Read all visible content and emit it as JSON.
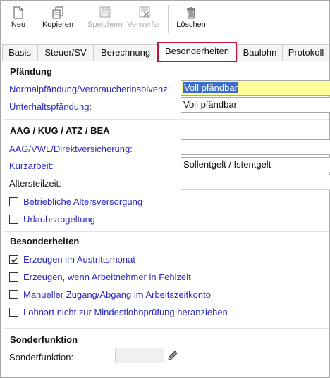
{
  "toolbar": {
    "new_label": "Neu",
    "copy_label": "Kopieren",
    "save_label": "Speichern",
    "discard_label": "Verwerfen",
    "delete_label": "Löschen"
  },
  "tabs": [
    {
      "label": "Basis"
    },
    {
      "label": "Steuer/SV"
    },
    {
      "label": "Berechnung"
    },
    {
      "label": "Besonderheiten"
    },
    {
      "label": "Baulohn"
    },
    {
      "label": "Protokoll"
    }
  ],
  "pfaendung": {
    "title": "Pfändung",
    "normal_label": "Normalpfändung/Verbraucherinsolvenz:",
    "normal_value": "Voll pfändbar",
    "unterhalt_label": "Unterhaltspfändung:",
    "unterhalt_value": "Voll pfändbar"
  },
  "aag": {
    "title": "AAG / KUG / ATZ / BEA",
    "vwl_label": "AAG/VWL/Direktversicherung:",
    "vwl_value": "",
    "kurzarbeit_label": "Kurzarbeit:",
    "kurzarbeit_value": "Sollentgelt / Istentgelt",
    "altersteilzeit_label": "Altersteilzeit:",
    "altersteilzeit_value": "",
    "checkboxes": [
      {
        "label": "Betriebliche Altersversorgung",
        "checked": false
      },
      {
        "label": "Urlaubsabgeltung",
        "checked": false
      }
    ]
  },
  "besonderheiten": {
    "title": "Besonderheiten",
    "checkboxes": [
      {
        "label": "Erzeugen im Austrittsmonat",
        "checked": true
      },
      {
        "label": "Erzeugen, wenn Arbeitnehmer in Fehlzeit",
        "checked": false
      },
      {
        "label": "Manueller Zugang/Abgang im Arbeitszeitkonto",
        "checked": false
      },
      {
        "label": "Lohnart nicht zur Mindestlohnprüfung heranziehen",
        "checked": false
      }
    ]
  },
  "sonderfunktion": {
    "title": "Sonderfunktion",
    "label": "Sonderfunktion:",
    "value": ""
  },
  "colors": {
    "label_blue": "#2a2ac0",
    "active_tab_border": "#c2123a",
    "highlight_field": "#ffff99",
    "selection": "#3a6fcf"
  }
}
